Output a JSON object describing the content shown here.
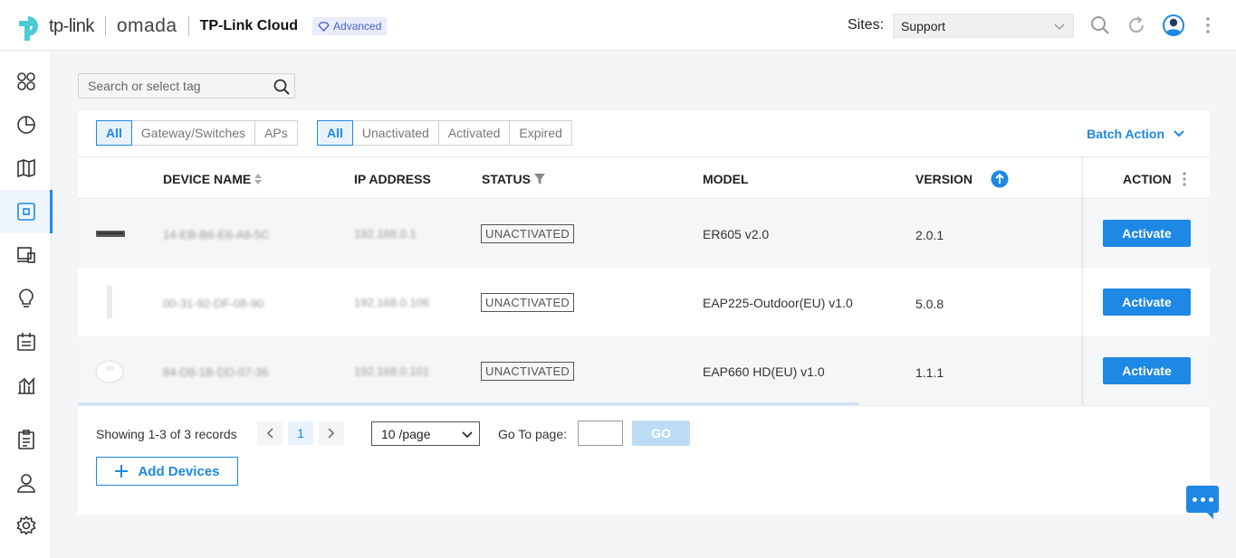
{
  "header": {
    "brand_tplink": "tp-link",
    "brand_omada": "omada",
    "app_title": "TP-Link Cloud",
    "badge": "Advanced",
    "sites_label": "Sites:",
    "site_selected": "Support",
    "accent": "#1e88e5"
  },
  "sidebar": {
    "items": [
      {
        "name": "dashboard-icon"
      },
      {
        "name": "statistics-icon"
      },
      {
        "name": "map-icon"
      },
      {
        "name": "devices-icon",
        "active": true
      },
      {
        "name": "clients-icon"
      },
      {
        "name": "insight-icon"
      },
      {
        "name": "schedule-icon"
      },
      {
        "name": "reports-icon"
      },
      {
        "name": "logs-icon"
      },
      {
        "name": "admin-icon"
      },
      {
        "name": "settings-icon"
      }
    ]
  },
  "search": {
    "placeholder": "Search or select tag"
  },
  "filters": {
    "type": [
      "All",
      "Gateway/Switches",
      "APs"
    ],
    "status": [
      "All",
      "Unactivated",
      "Activated",
      "Expired"
    ]
  },
  "batch_action": "Batch Action",
  "table": {
    "headers": {
      "device_name": "DEVICE NAME",
      "ip_address": "IP ADDRESS",
      "status": "STATUS",
      "model": "MODEL",
      "version": "VERSION",
      "action": "ACTION"
    },
    "rows": [
      {
        "name": "14-EB-B6-E6-A6-5C",
        "ip": "192.168.0.1",
        "status": "UNACTIVATED",
        "model": "ER605 v2.0",
        "version": "2.0.1",
        "action": "Activate"
      },
      {
        "name": "00-31-92-DF-08-90",
        "ip": "192.168.0.106",
        "status": "UNACTIVATED",
        "model": "EAP225-Outdoor(EU) v1.0",
        "version": "5.0.8",
        "action": "Activate"
      },
      {
        "name": "84-D8-1B-DD-07-36",
        "ip": "192.168.0.101",
        "status": "UNACTIVATED",
        "model": "EAP660 HD(EU) v1.0",
        "version": "1.1.1",
        "action": "Activate"
      }
    ]
  },
  "pagination": {
    "showing": "Showing 1-3 of 3 records",
    "current_page": "1",
    "per_page": "10 /page",
    "goto_label": "Go To page:",
    "go": "GO"
  },
  "add_devices": "Add Devices"
}
